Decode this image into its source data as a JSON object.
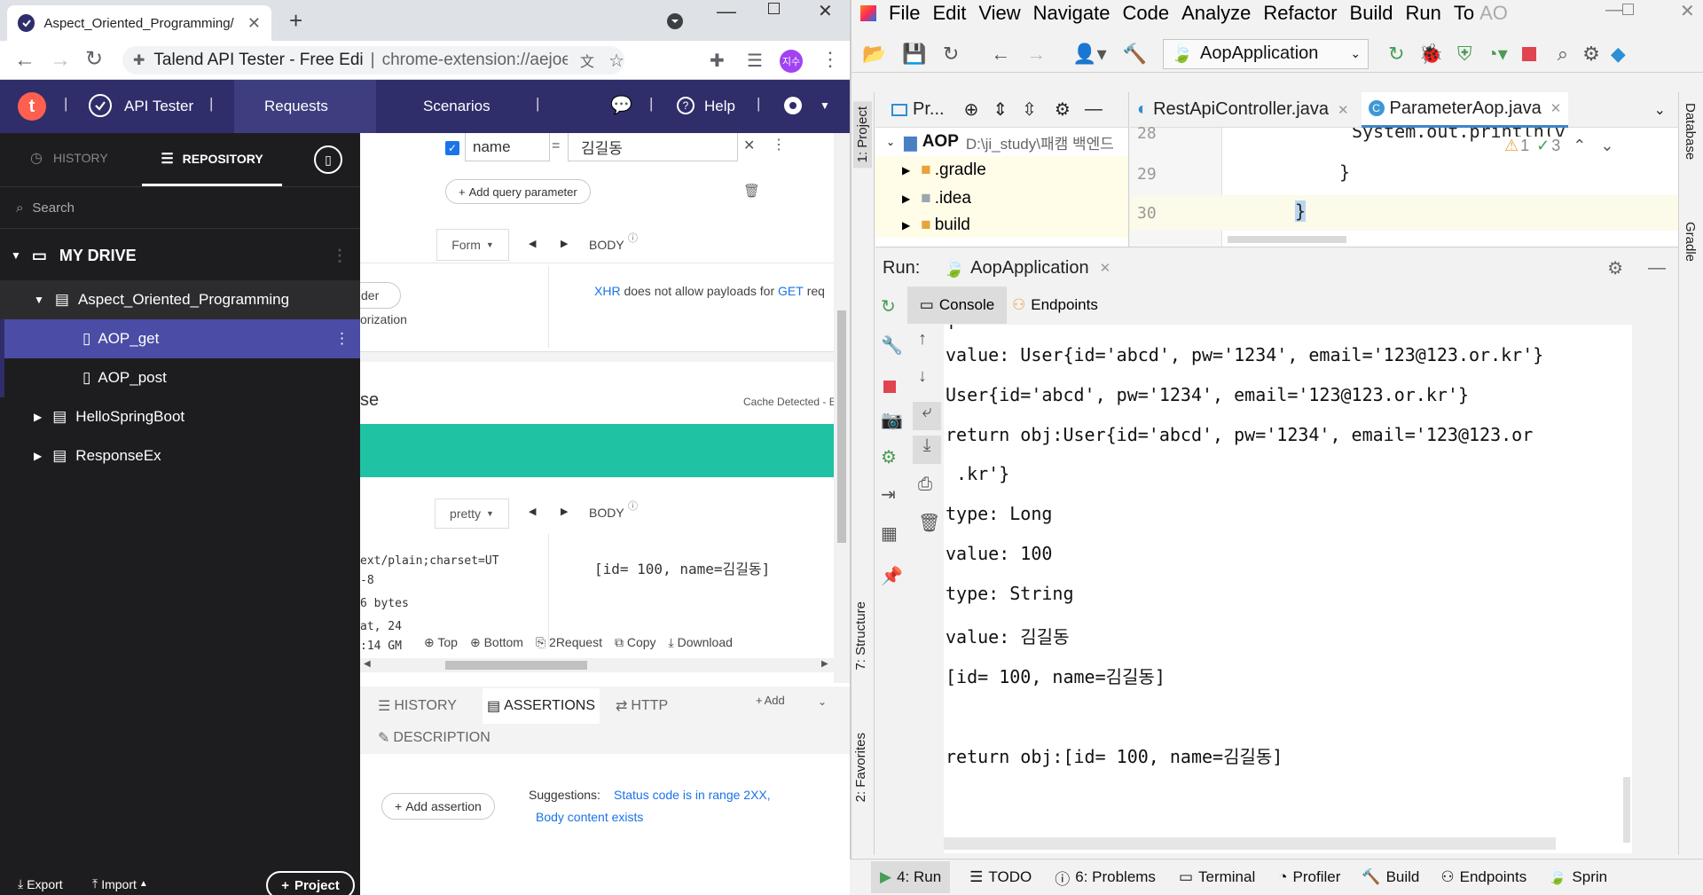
{
  "browser": {
    "tab_title": "Aspect_Oriented_Programming/",
    "omnibox_title": "Talend API Tester - Free Edi",
    "omnibox_url": "chrome-extension://aejoelaogge...",
    "profile_label": "지수"
  },
  "talend": {
    "logo": "t",
    "nav": {
      "api_tester": "API Tester",
      "requests": "Requests",
      "scenarios": "Scenarios",
      "help": "Help"
    },
    "sidebar": {
      "history_tab": "HISTORY",
      "repository_tab": "REPOSITORY",
      "search_placeholder": "Search",
      "drive": "MY DRIVE",
      "items": [
        {
          "label": "Aspect_Oriented_Programming"
        },
        {
          "label": "AOP_get"
        },
        {
          "label": "AOP_post"
        },
        {
          "label": "HelloSpringBoot"
        },
        {
          "label": "ResponseEx"
        }
      ],
      "export": "Export",
      "import": "Import",
      "project": "Project"
    },
    "request": {
      "param_name": "name",
      "param_eq": "=",
      "param_value": "김길동",
      "add_query_param": "Add query parameter",
      "form": "Form",
      "body": "BODY",
      "header_partial": "der",
      "auth_partial": "orization",
      "xhr": "XHR",
      "xhr_msg": "does not allow payloads for",
      "get": "GET",
      "req_partial": "req"
    },
    "response": {
      "title_partial": "se",
      "cache": "Cache Detected - E",
      "pretty": "pretty",
      "body": "BODY",
      "content_type": "ext/plain;charset=UT",
      "content_type_2": "-8",
      "size": "6 bytes",
      "date": "at, 24",
      "time": ":14 GM",
      "body_value": "[id= 100, name=김길동]",
      "top": "Top",
      "bottom": "Bottom",
      "to_request": "2Request",
      "copy": "Copy",
      "download": "Download"
    },
    "bottom_tabs": {
      "history": "HISTORY",
      "assertions": "ASSERTIONS",
      "http": "HTTP",
      "add": "Add",
      "description": "DESCRIPTION",
      "add_assertion": "Add assertion",
      "suggestions": "Suggestions:",
      "sugg1": "Status code is in range 2XX,",
      "sugg2": "Body content exists"
    }
  },
  "intellij": {
    "menu": [
      "File",
      "Edit",
      "View",
      "Navigate",
      "Code",
      "Analyze",
      "Refactor",
      "Build",
      "Run",
      "To"
    ],
    "menu_more": "AO",
    "run_config": "AopApplication",
    "project_panel": {
      "label": "Pr...",
      "root": "AOP",
      "root_path": "D:\\ji_study\\패캠 백엔드",
      "items": [
        ".gradle",
        ".idea",
        "build"
      ]
    },
    "editor_tabs": [
      "RestApiController.java",
      "ParameterAop.java"
    ],
    "editor": {
      "lines": [
        {
          "no": "28",
          "code": "System.out.println(v"
        },
        {
          "no": "29",
          "code": "}"
        },
        {
          "no": "30",
          "code": "}"
        }
      ],
      "warnings": "1",
      "checks": "3"
    },
    "run": {
      "label": "Run:",
      "config": "AopApplication",
      "console_tab": "Console",
      "endpoints_tab": "Endpoints",
      "output": [
        "value: User{id='abcd', pw='1234', email='123@123.or.kr'}",
        "User{id='abcd', pw='1234', email='123@123.or.kr'}",
        "return obj:User{id='abcd', pw='1234', email='123@123.or",
        " .kr'}",
        "type: Long",
        "value: 100",
        "type: String",
        "value: 김길동",
        "[id= 100, name=김길동]",
        "",
        "return obj:[id= 100, name=김길동]"
      ]
    },
    "side_tabs": {
      "project": "1: Project",
      "structure": "7: Structure",
      "favorites": "2: Favorites",
      "database": "Database",
      "gradle": "Gradle"
    },
    "status": [
      "4: Run",
      "TODO",
      "6: Problems",
      "Terminal",
      "Profiler",
      "Build",
      "Endpoints",
      "Sprin"
    ],
    "colors": {
      "accent": "#2f2e6b",
      "teal": "#1fc2a2",
      "brand_red": "#ff5f4e"
    }
  }
}
